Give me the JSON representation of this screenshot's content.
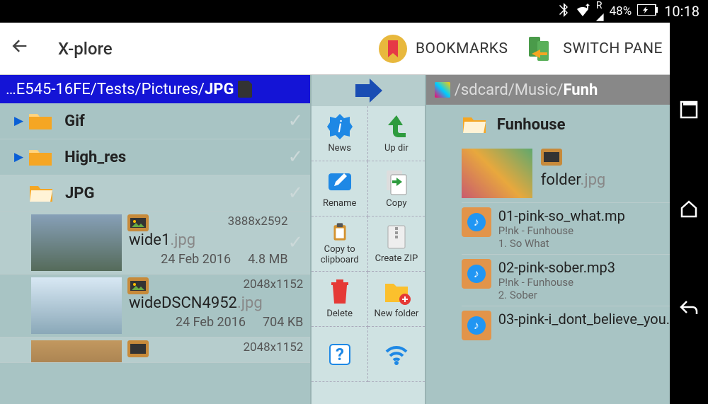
{
  "status": {
    "battery": "48%",
    "time": "10:18"
  },
  "appbar": {
    "title": "X-plore",
    "bookmarks": "BOOKMARKS",
    "switch_pane": "SWITCH PANE"
  },
  "left_path": {
    "prefix": "…E545-16FE/Tests/Pictures/",
    "current": "JPG"
  },
  "right_path": {
    "prefix": "/sdcard/Music/",
    "current": "Funh"
  },
  "left_folders": [
    {
      "name": "Gif"
    },
    {
      "name": "High_res"
    },
    {
      "name": "JPG"
    }
  ],
  "left_files": [
    {
      "dims": "3888x2592",
      "name": "wide1",
      "ext": ".jpg",
      "date": "24 Feb 2016",
      "size": "4.8 MB"
    },
    {
      "dims": "2048x1152",
      "name": "wideDSCN4952",
      "ext": ".jpg",
      "date": "24 Feb 2016",
      "size": "704 KB"
    },
    {
      "dims": "2048x1152",
      "name": "",
      "ext": "",
      "date": "",
      "size": ""
    }
  ],
  "actions": {
    "news": "News",
    "updir": "Up dir",
    "rename": "Rename",
    "copy": "Copy",
    "clipboard": "Copy to clipboard",
    "zip": "Create ZIP",
    "delete": "Delete",
    "newfolder": "New folder"
  },
  "right_folder": {
    "name": "Funhouse",
    "thumb_name": "folder",
    "thumb_ext": ".jpg"
  },
  "music": [
    {
      "file": "01-pink-so_what.mp",
      "artist": "P!nk - Funhouse",
      "track": "1.  So What"
    },
    {
      "file": "02-pink-sober.mp3",
      "artist": "P!nk - Funhouse",
      "track": "2.  Sober"
    },
    {
      "file": "03-pink-i_dont_believe_you.",
      "artist": "",
      "track": ""
    }
  ]
}
